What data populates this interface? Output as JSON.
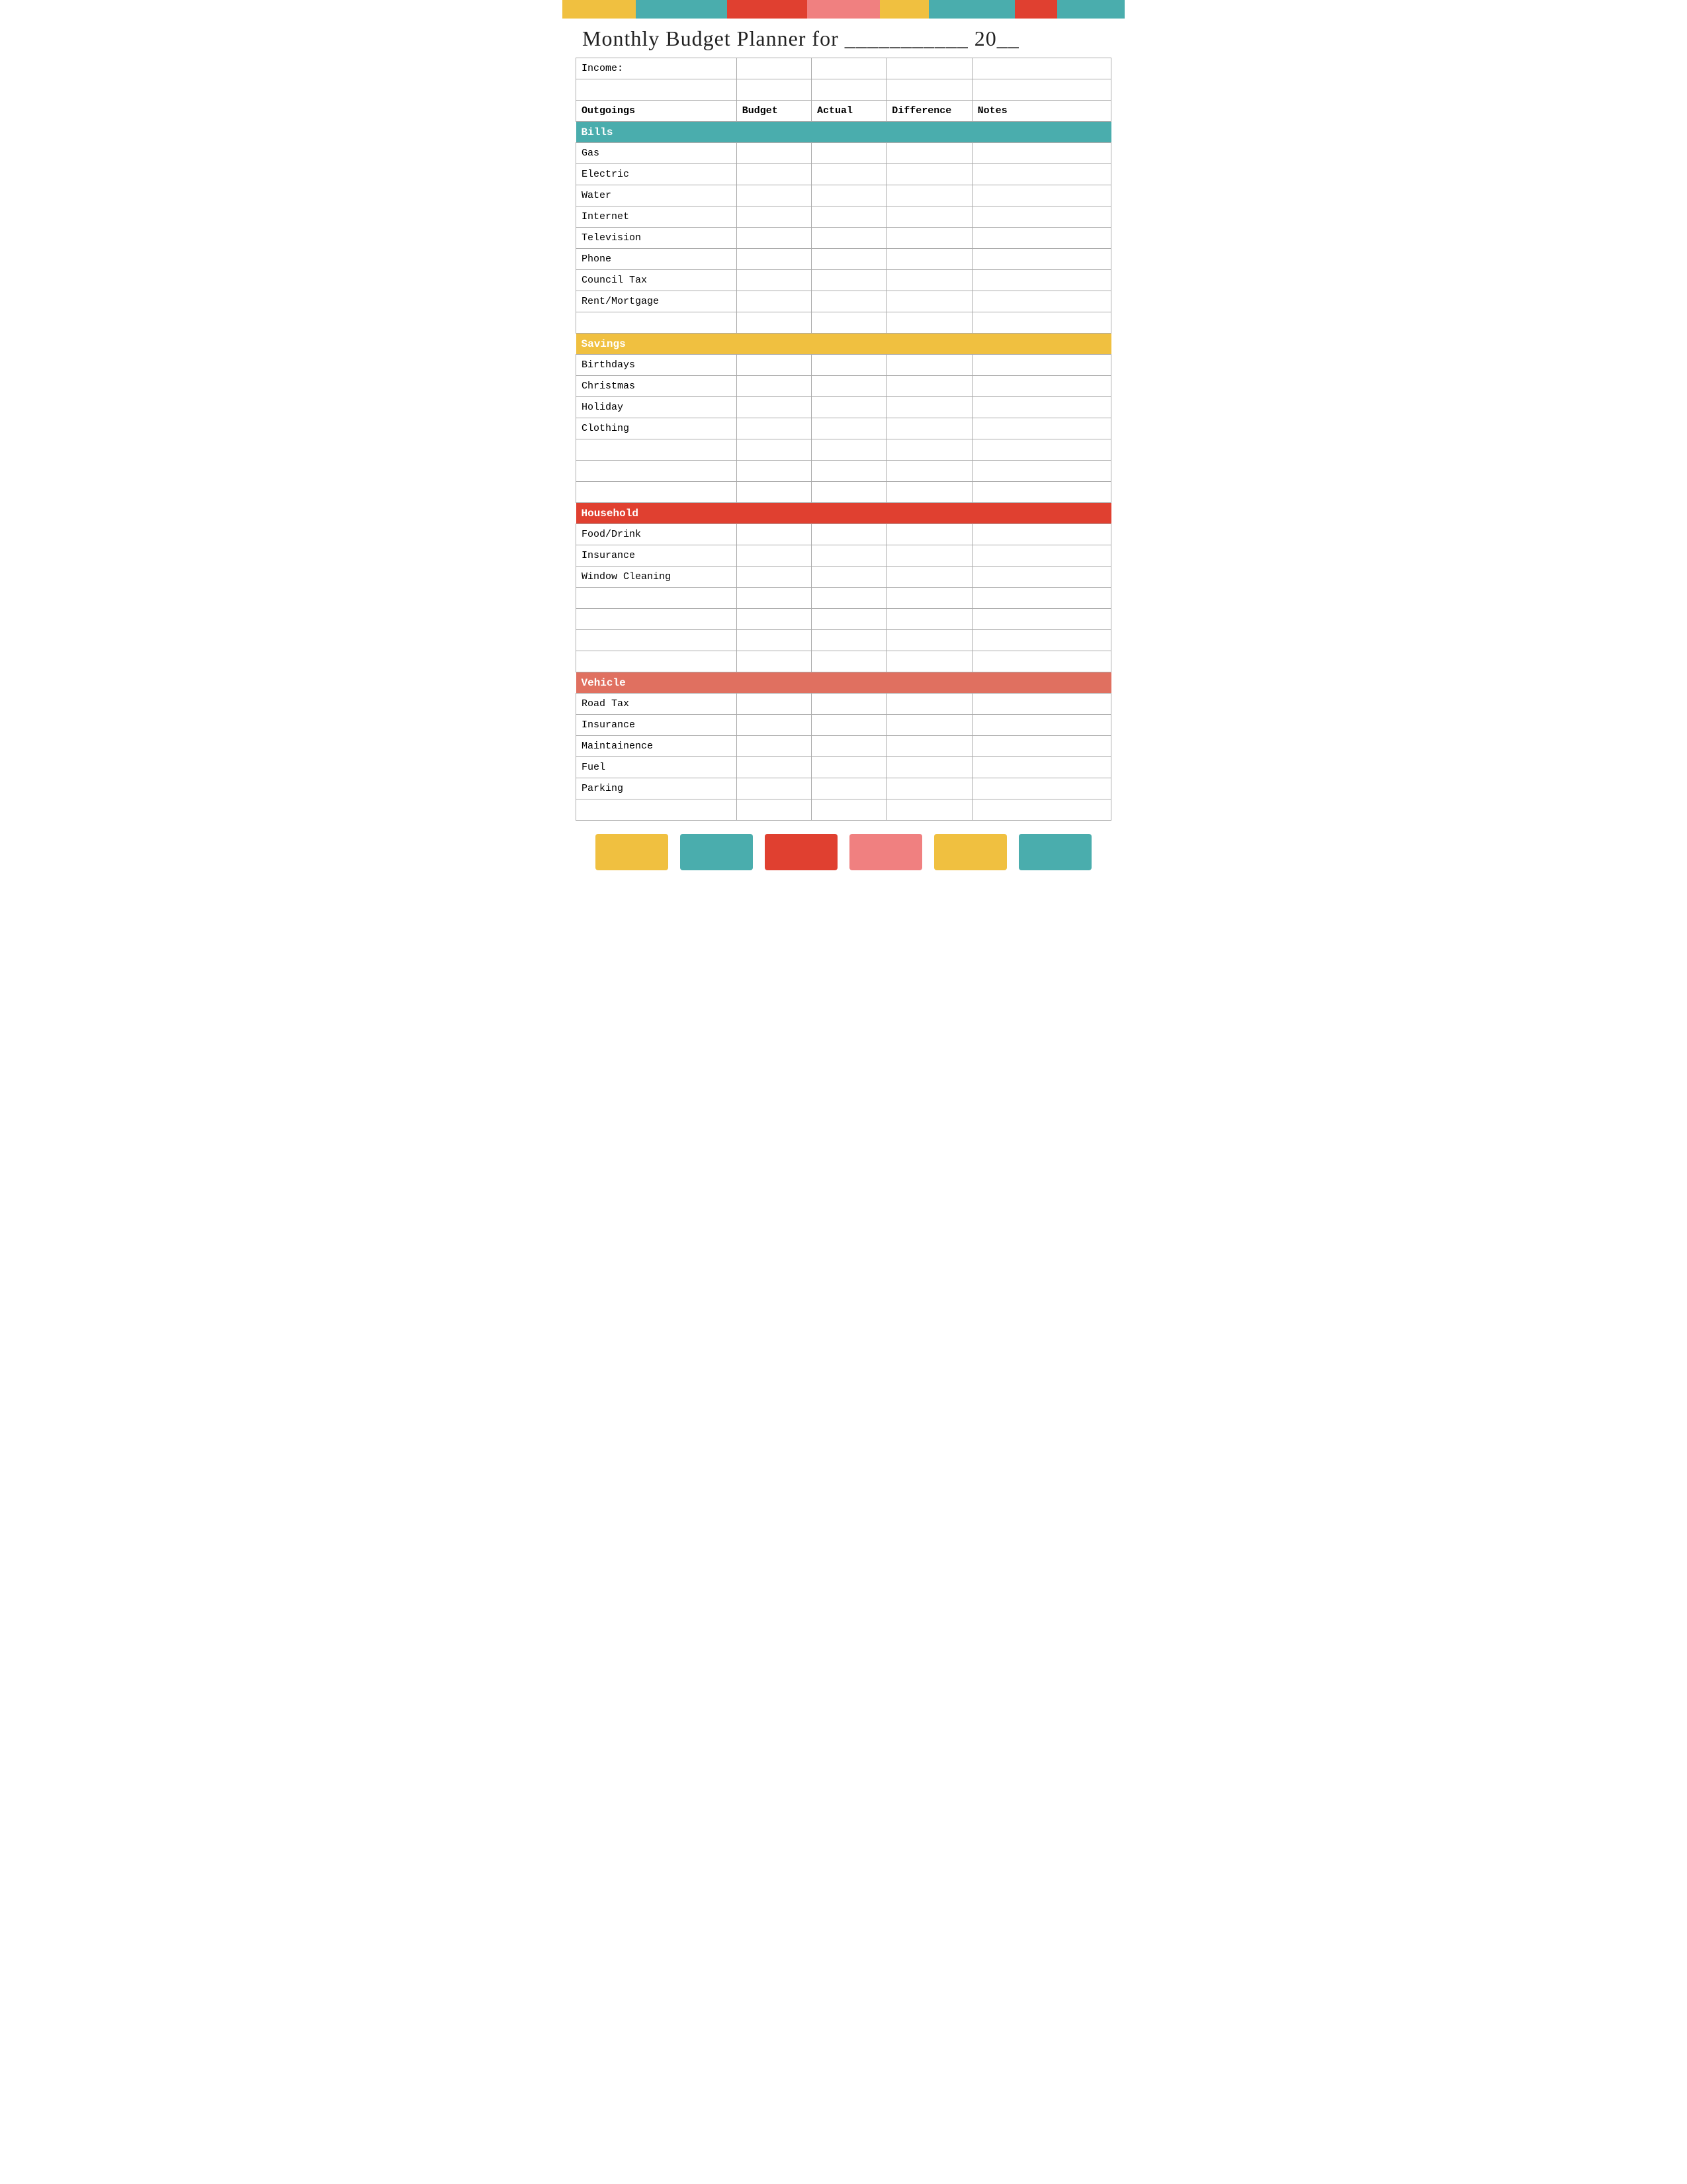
{
  "topBar": [
    {
      "color": "#F0C040",
      "flex": "1.2"
    },
    {
      "color": "#4AADAD",
      "flex": "1.5"
    },
    {
      "color": "#E04030",
      "flex": "1.3"
    },
    {
      "color": "#F08080",
      "flex": "1.2"
    },
    {
      "color": "#F0C040",
      "flex": "0.8"
    },
    {
      "color": "#4AADAD",
      "flex": "1.4"
    },
    {
      "color": "#E04030",
      "flex": "0.7"
    },
    {
      "color": "#4AADAD",
      "flex": "1.1"
    }
  ],
  "bottomBar": [
    {
      "color": "#F0C040"
    },
    {
      "color": "#4AADAD"
    },
    {
      "color": "#E04030"
    },
    {
      "color": "#F08080"
    },
    {
      "color": "#F0C040"
    },
    {
      "color": "#4AADAD"
    }
  ],
  "title": "Monthly Budget Planner for ___________ 20__",
  "columns": {
    "label": "Outgoings",
    "budget": "Budget",
    "actual": "Actual",
    "difference": "Difference",
    "notes": "Notes"
  },
  "income_label": "Income:",
  "sections": [
    {
      "name": "Bills",
      "color_class": "section-bills",
      "items": [
        "Gas",
        "Electric",
        "Water",
        "Internet",
        "Television",
        "Phone",
        "Council Tax",
        "Rent/Mortgage"
      ]
    },
    {
      "name": "Savings",
      "color_class": "section-savings",
      "items": [
        "Birthdays",
        "Christmas",
        "Holiday",
        "Clothing"
      ]
    },
    {
      "name": "Household",
      "color_class": "section-household",
      "items": [
        "Food/Drink",
        "Insurance",
        "Window Cleaning"
      ]
    },
    {
      "name": "Vehicle",
      "color_class": "section-vehicle",
      "items": [
        "Road Tax",
        "Insurance",
        "Maintainence",
        "Fuel",
        "Parking"
      ]
    }
  ]
}
